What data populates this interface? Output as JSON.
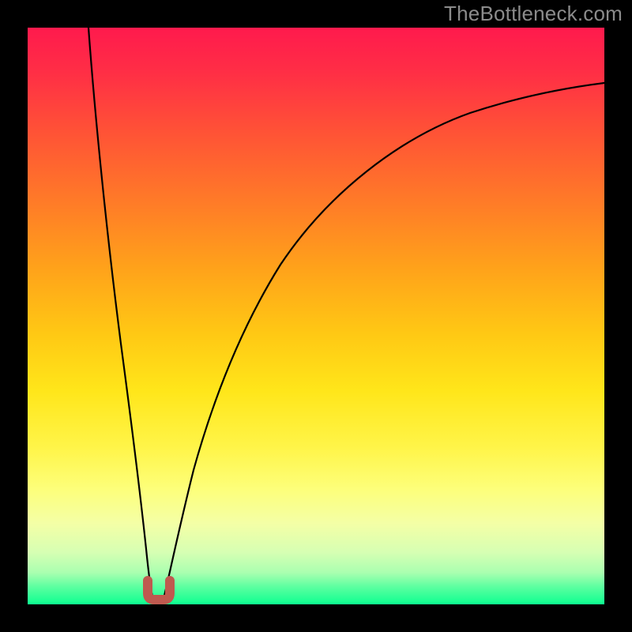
{
  "watermark": "TheBottleneck.com",
  "chart_data": {
    "type": "line",
    "title": "",
    "xlabel": "",
    "ylabel": "",
    "xlim": [
      0,
      100
    ],
    "ylim": [
      0,
      100
    ],
    "grid": false,
    "series": [
      {
        "name": "left-curve",
        "x": [
          10.5,
          11.0,
          11.8,
          12.8,
          14.0,
          15.2,
          16.4,
          17.8,
          19.2,
          20.5
        ],
        "y": [
          100,
          88,
          76,
          62,
          48,
          35,
          22,
          11,
          3,
          0
        ]
      },
      {
        "name": "right-curve",
        "x": [
          22.5,
          24,
          26,
          29,
          33,
          38,
          44,
          51,
          59,
          68,
          78,
          88,
          100
        ],
        "y": [
          0,
          6,
          14,
          24,
          35,
          45,
          54,
          62,
          69,
          75,
          80,
          84,
          88
        ]
      },
      {
        "name": "optimum-marker",
        "x": [
          20.5,
          22.5
        ],
        "y": [
          0,
          0
        ],
        "note": "U-shaped highlight at minimum"
      }
    ],
    "gradient": {
      "direction": "vertical",
      "stops": [
        {
          "pos": 0,
          "color": "#ff1a4d"
        },
        {
          "pos": 0.5,
          "color": "#ffd61a"
        },
        {
          "pos": 0.85,
          "color": "#f4ffa6"
        },
        {
          "pos": 1.0,
          "color": "#0dff90"
        }
      ]
    }
  }
}
